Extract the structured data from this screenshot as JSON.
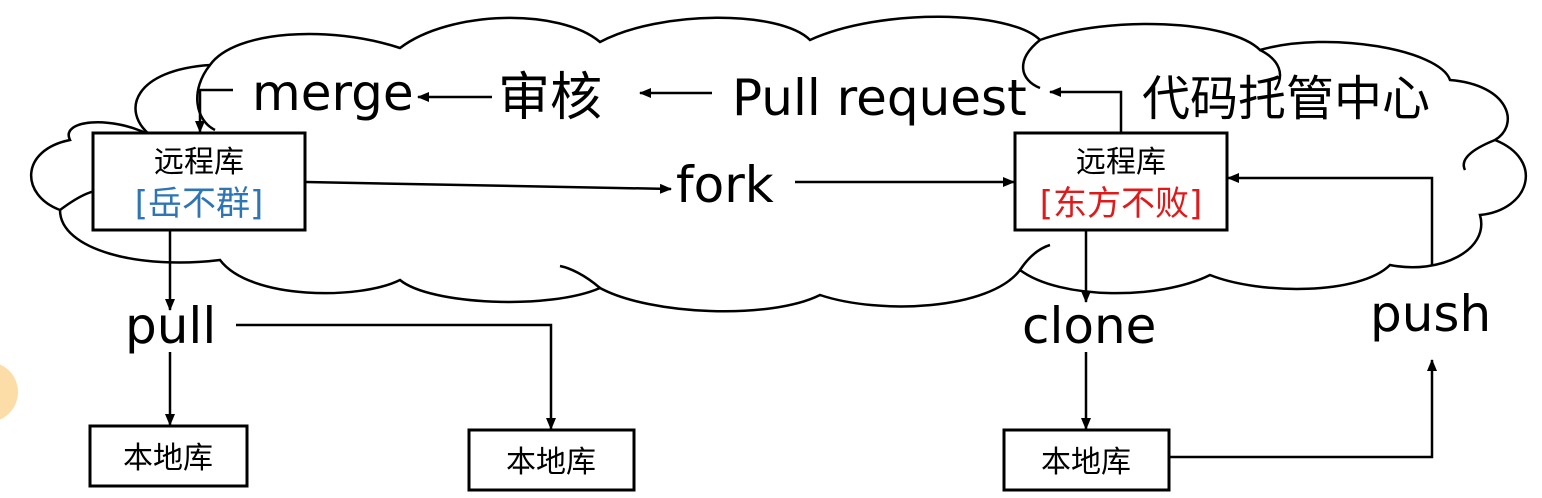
{
  "cloud_label": "代码托管中心",
  "flow": {
    "merge": "merge",
    "review": "审核",
    "pull_request": "Pull request",
    "fork": "fork",
    "pull": "pull",
    "clone": "clone",
    "push": "push"
  },
  "remote_left": {
    "title": "远程库",
    "owner": "[岳不群]",
    "owner_color": "#2E75B6"
  },
  "remote_right": {
    "title": "远程库",
    "owner": "[东方不败]",
    "owner_color": "#E0191A"
  },
  "local_repos": [
    "本地库",
    "本地库",
    "本地库"
  ],
  "colors": {
    "line": "#000000",
    "accent_circle": "#FCDDA8"
  }
}
